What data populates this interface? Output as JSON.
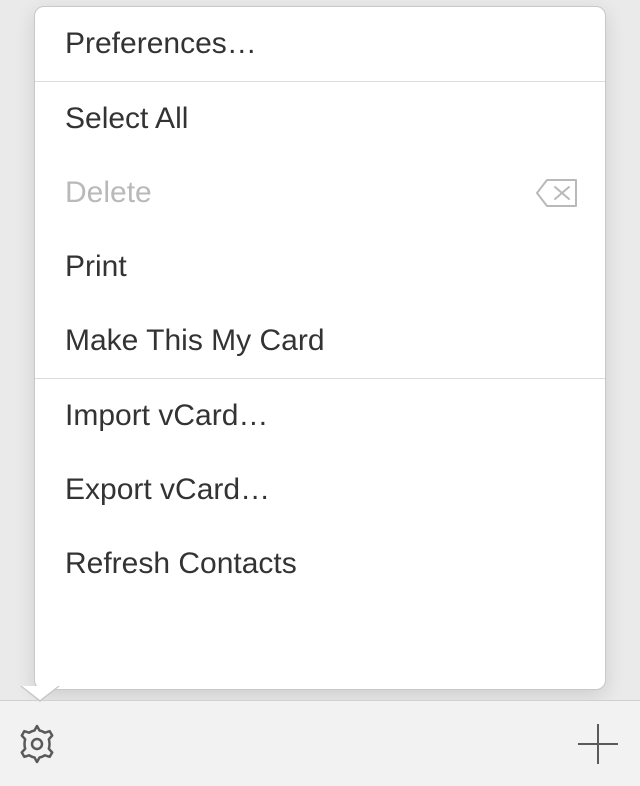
{
  "menu": {
    "group1": [
      {
        "label": "Preferences…"
      }
    ],
    "group2": [
      {
        "label": "Select All"
      },
      {
        "label": "Delete",
        "disabled": true,
        "icon": "delete-icon"
      },
      {
        "label": "Print"
      },
      {
        "label": "Make This My Card"
      }
    ],
    "group3": [
      {
        "label": "Import vCard…"
      },
      {
        "label": "Export vCard…"
      },
      {
        "label": "Refresh Contacts"
      }
    ]
  },
  "toolbar": {
    "settings_label": "Settings",
    "add_label": "Add"
  }
}
